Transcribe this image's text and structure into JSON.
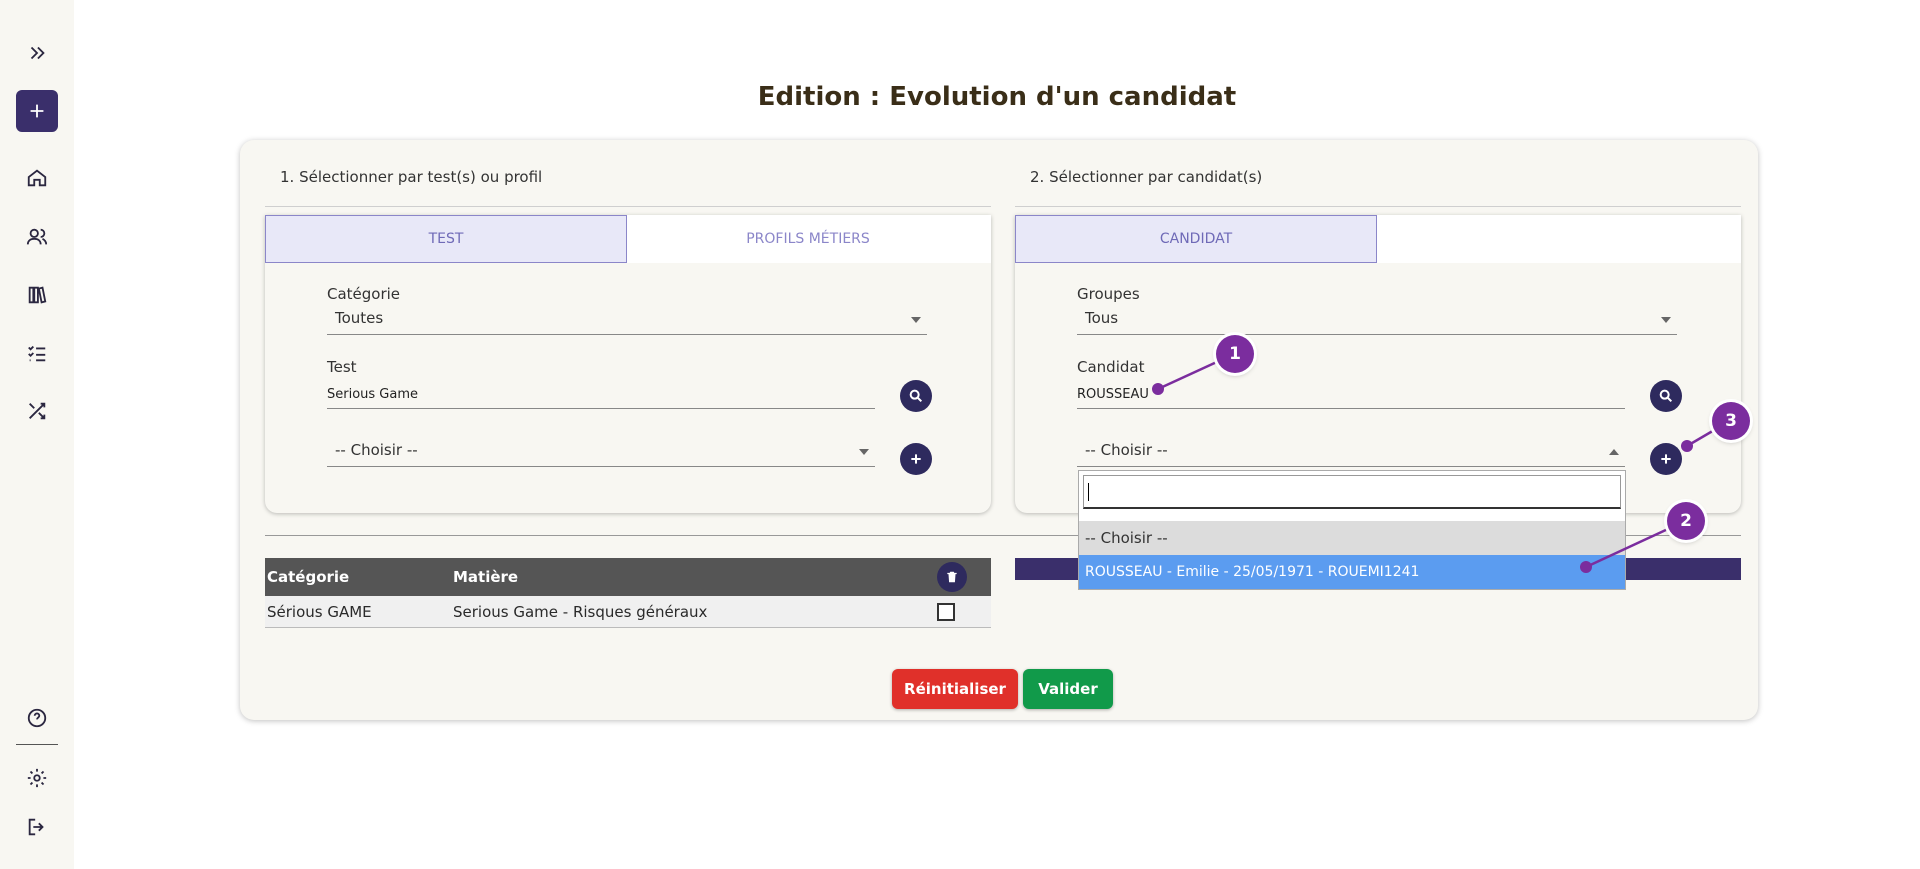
{
  "page": {
    "title": "Edition : Evolution d'un candidat"
  },
  "sidebar": {
    "items": [
      {
        "icon": "double-chevron-right-icon"
      },
      {
        "icon": "plus-icon"
      },
      {
        "icon": "home-icon"
      },
      {
        "icon": "users-icon"
      },
      {
        "icon": "library-icon"
      },
      {
        "icon": "checklist-icon"
      },
      {
        "icon": "shuffle-icon"
      },
      {
        "icon": "help-icon"
      },
      {
        "icon": "gear-icon"
      },
      {
        "icon": "logout-icon"
      }
    ]
  },
  "left": {
    "section_label": "1. Sélectionner par test(s) ou profil",
    "tabs": [
      {
        "label": "TEST",
        "active": true
      },
      {
        "label": "PROFILS MÉTIERS",
        "active": false
      }
    ],
    "category_label": "Catégorie",
    "category_value": "Toutes",
    "test_label": "Test",
    "test_value": "Serious Game",
    "choose_value": "-- Choisir --"
  },
  "right": {
    "section_label": "2. Sélectionner par candidat(s)",
    "tabs": [
      {
        "label": "CANDIDAT",
        "active": true
      }
    ],
    "groups_label": "Groupes",
    "groups_value": "Tous",
    "candidate_label": "Candidat",
    "candidate_value": "ROUSSEAU",
    "choose_value": "-- Choisir --",
    "dropdown": {
      "search_value": "",
      "options": [
        "-- Choisir --",
        "ROUSSEAU - Emilie - 25/05/1971 - ROUEMI1241"
      ]
    }
  },
  "table": {
    "headers": [
      "Catégorie",
      "Matière"
    ],
    "rows": [
      {
        "category": "Sérious GAME",
        "subject": "Serious Game - Risques généraux"
      }
    ]
  },
  "actions": {
    "reset_label": "Réinitialiser",
    "validate_label": "Valider"
  },
  "annotations": [
    "1",
    "2",
    "3"
  ],
  "colors": {
    "primary": "#3a2f6b",
    "reset": "#e0302a",
    "validate": "#119a4a",
    "annotation": "#7b2d9e",
    "selected_option": "#5b9cf0"
  }
}
